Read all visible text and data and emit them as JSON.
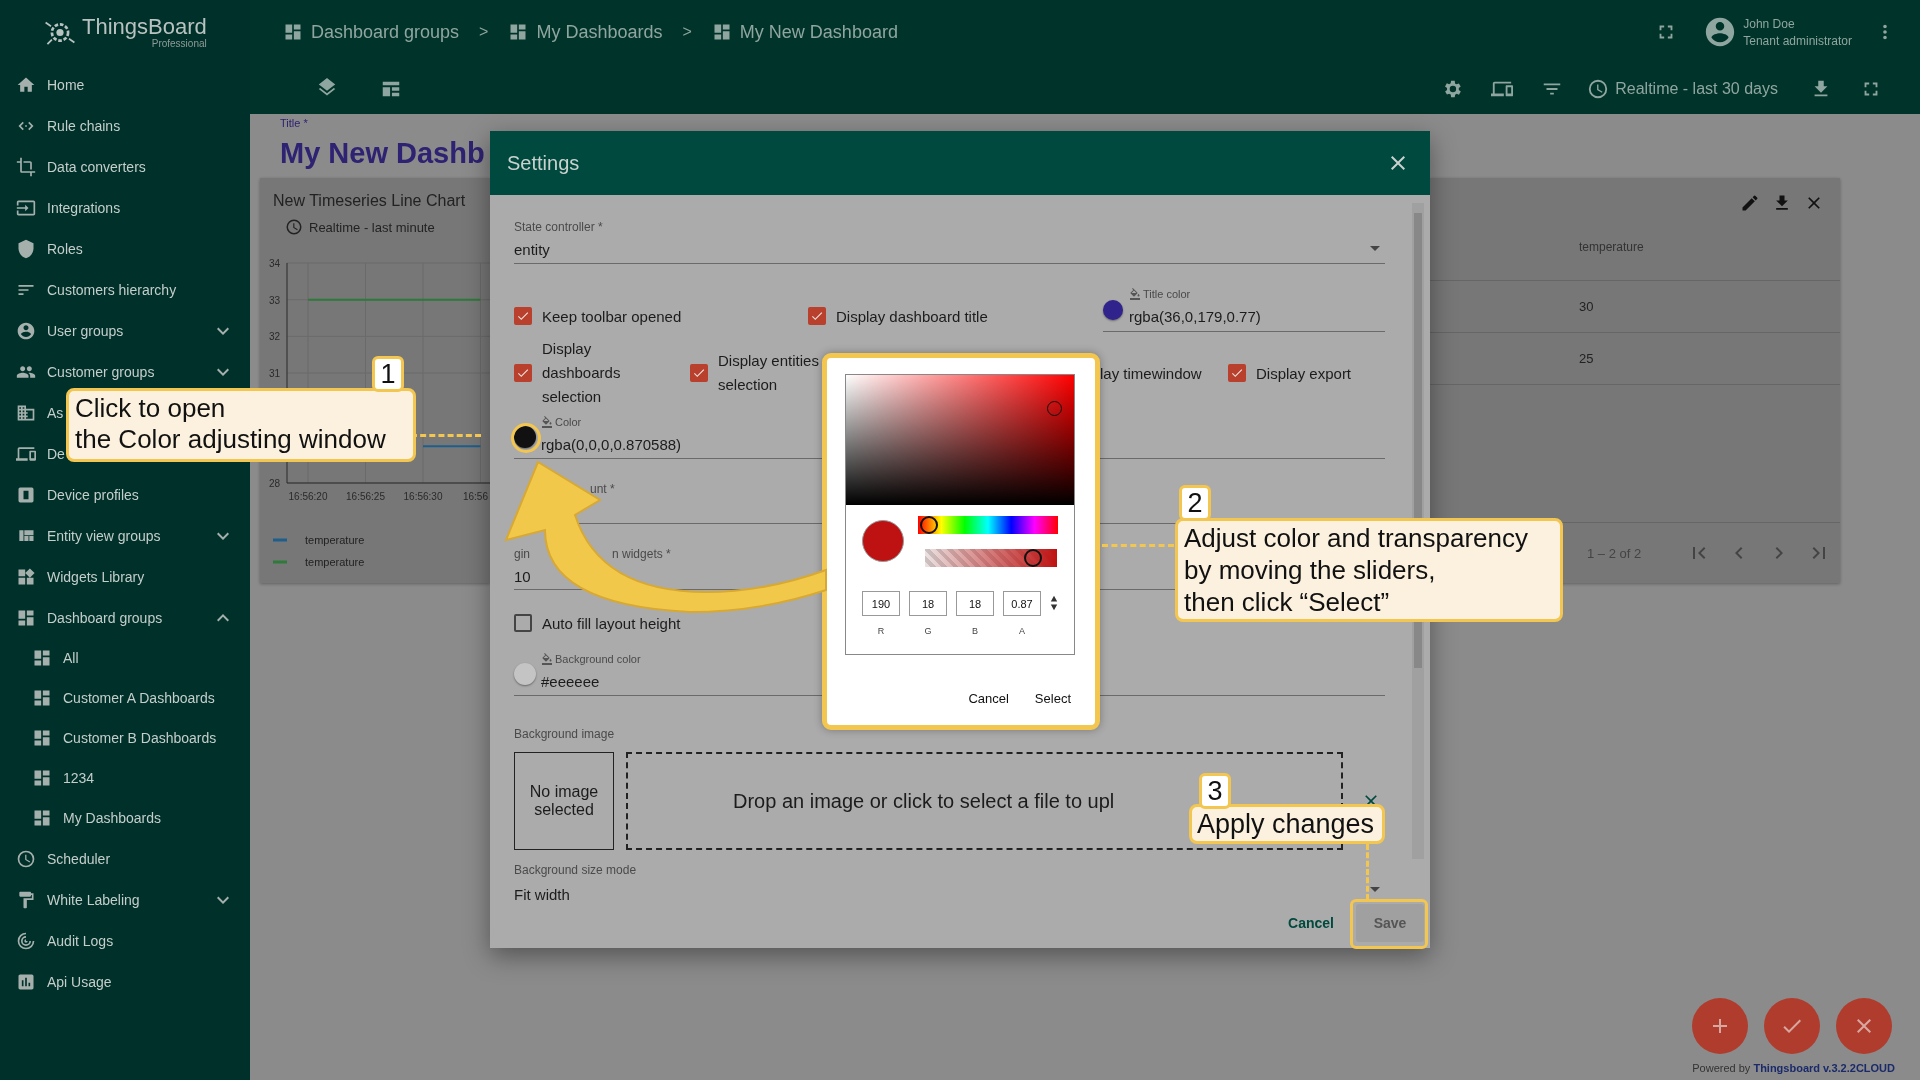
{
  "sidebar": {
    "logo": {
      "name": "ThingsBoard",
      "edition": "Professional"
    },
    "items": [
      {
        "label": "Home"
      },
      {
        "label": "Rule chains"
      },
      {
        "label": "Data converters"
      },
      {
        "label": "Integrations"
      },
      {
        "label": "Roles"
      },
      {
        "label": "Customers hierarchy"
      },
      {
        "label": "User groups",
        "expanded": false
      },
      {
        "label": "Customer groups",
        "expanded": false
      },
      {
        "label": "As"
      },
      {
        "label": "De"
      },
      {
        "label": "Device profiles"
      },
      {
        "label": "Entity view groups",
        "expanded": false
      },
      {
        "label": "Widgets Library"
      },
      {
        "label": "Dashboard groups",
        "expanded": true,
        "children": [
          {
            "label": "All"
          },
          {
            "label": "Customer A Dashboards"
          },
          {
            "label": "Customer B Dashboards"
          },
          {
            "label": "1234"
          },
          {
            "label": "My Dashboards"
          }
        ]
      },
      {
        "label": "Scheduler"
      },
      {
        "label": "White Labeling",
        "expanded": false
      },
      {
        "label": "Audit Logs"
      },
      {
        "label": "Api Usage"
      }
    ]
  },
  "header": {
    "breadcrumbs": [
      "Dashboard groups",
      "My Dashboards",
      "My New Dashboard"
    ],
    "separators": [
      ">",
      ">"
    ],
    "user": {
      "name": "John Doe",
      "role": "Tenant administrator"
    },
    "timewindow": "Realtime - last 30 days"
  },
  "dashboard": {
    "title_label": "Title *",
    "title": "My New Dashb",
    "chart_widget": {
      "title": "New Timeseries Line Chart",
      "timewindow": "Realtime - last minute",
      "chart_data": {
        "type": "line",
        "categories": [
          "16:56:20",
          "16:56:25",
          "16:56:30",
          "16:56"
        ],
        "ylim": [
          28,
          34
        ],
        "yticks": [
          28,
          31,
          32,
          33,
          34
        ],
        "grid": true,
        "series": [
          {
            "name": "temperature",
            "color": "#1d5f8c",
            "values": [
              null,
              null,
              29,
              29
            ]
          },
          {
            "name": "temperature",
            "color": "#2e7a3a",
            "values": [
              33,
              33,
              33,
              33
            ]
          }
        ]
      }
    },
    "table_widget": {
      "column": "temperature",
      "rows": [
        "30",
        "25"
      ],
      "paging": "1 – 2 of 2"
    }
  },
  "dialog": {
    "title": "Settings",
    "state_controller": {
      "label": "State controller *",
      "value": "entity"
    },
    "row1": [
      {
        "label": "Keep toolbar opened",
        "checked": true
      },
      {
        "label": "Display dashboard title",
        "checked": true
      }
    ],
    "title_color": {
      "label": "Title color",
      "value": "rgba(36,0,179,0.77)",
      "color": "#31238c"
    },
    "row2": [
      {
        "label": "Display dashboards selection",
        "checked": true
      },
      {
        "label": "Display entities selection",
        "checked": true
      }
    ],
    "row2_partial": "lay timewindow",
    "row2_last": {
      "label": "Display export",
      "checked": true
    },
    "color": {
      "label": "Color",
      "value": "rgba(0,0,0,0.870588)",
      "color": "#111111"
    },
    "column_count": {
      "label": "unt *"
    },
    "margin": {
      "label_start": "gin",
      "label_end": "n widgets *",
      "value": "10"
    },
    "auto_fill": {
      "label": "Auto fill layout height",
      "checked": false
    },
    "background_color": {
      "label": "Background color",
      "value": "#eeeeee",
      "color": "#c4c4c4"
    },
    "background_image": {
      "label": "Background image",
      "preview": "No image selected",
      "drop": "Drop an image or click to select a file to upl"
    },
    "size_mode": {
      "label": "Background size mode",
      "value": "Fit width"
    },
    "buttons": {
      "cancel": "Cancel",
      "save": "Save"
    }
  },
  "color_picker": {
    "hue": {
      "level": 0.02
    },
    "alpha": {
      "level": 0.87
    },
    "preview": {
      "color": "#be1212"
    },
    "inputs": [
      {
        "value": "190",
        "label": "R"
      },
      {
        "value": "18",
        "label": "G"
      },
      {
        "value": "18",
        "label": "B"
      },
      {
        "value": "0.87",
        "label": "A"
      }
    ],
    "buttons": [
      "Cancel",
      "Select"
    ]
  },
  "callouts": [
    {
      "number": "1",
      "lines": [
        "Click to open",
        "the Color adjusting window"
      ]
    },
    {
      "number": "2",
      "lines": [
        "Adjust color and transparency",
        "by moving the sliders,",
        "then click “Select”"
      ]
    },
    {
      "number": "3",
      "lines": [
        "Apply changes"
      ]
    }
  ],
  "footer": "Powered by **Thingsboard v.3.2.2CLOUD**"
}
